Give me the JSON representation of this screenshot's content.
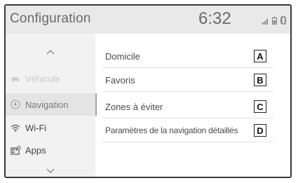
{
  "header": {
    "title": "Configuration",
    "time": "6:32",
    "status_icons": [
      "signal-icon",
      "battery-icon",
      "bluetooth-icon"
    ]
  },
  "sidebar": {
    "items": [
      {
        "label": "Véhicule",
        "icon": "car-icon",
        "state": "dimmed"
      },
      {
        "label": "Navigation",
        "icon": "compass-icon",
        "state": "selected"
      },
      {
        "label": "Wi-Fi",
        "icon": "wifi-icon",
        "state": "normal"
      },
      {
        "label": "Apps",
        "icon": "apps-icon",
        "state": "normal"
      }
    ]
  },
  "menu": {
    "items": [
      {
        "label": "Domicile",
        "callout": "A"
      },
      {
        "label": "Favoris",
        "callout": "B"
      },
      {
        "label": "Zones à éviter",
        "callout": "C"
      },
      {
        "label": "Paramètres de la navigation détaillés",
        "callout": "D"
      }
    ]
  }
}
